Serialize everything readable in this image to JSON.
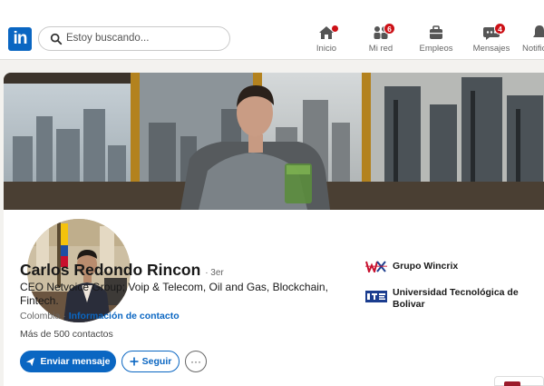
{
  "nav": {
    "search_placeholder": "Estoy buscando...",
    "items": [
      {
        "label": "Inicio",
        "icon": "home-icon",
        "badge": ""
      },
      {
        "label": "Mi red",
        "icon": "network-icon",
        "badge": "6"
      },
      {
        "label": "Empleos",
        "icon": "briefcase-icon",
        "badge": ""
      },
      {
        "label": "Mensajes",
        "icon": "messaging-icon",
        "badge": "4"
      },
      {
        "label": "Notific",
        "icon": "bell-icon",
        "badge": ""
      }
    ]
  },
  "profile": {
    "name": "Carlos Redondo Rincon",
    "degree": "· 3er",
    "headline": "CEO Netvoice Group; Voip & Telecom, Oil and Gas, Blockchain, Fintech.",
    "location": "Colombia",
    "separator": " · ",
    "contact_info": "Información de contacto",
    "connections": "Más de 500 contactos",
    "message_button": "Enviar mensaje",
    "follow_button": "Seguir",
    "more_button": "···"
  },
  "companies": [
    {
      "label": "Grupo Wincrix",
      "logo_text": "WX"
    },
    {
      "label": "Universidad Tecnológica de Bolivar",
      "logo_text": "UTB"
    }
  ],
  "colors": {
    "brand": "#0a66c2",
    "badge": "#cc1016"
  }
}
